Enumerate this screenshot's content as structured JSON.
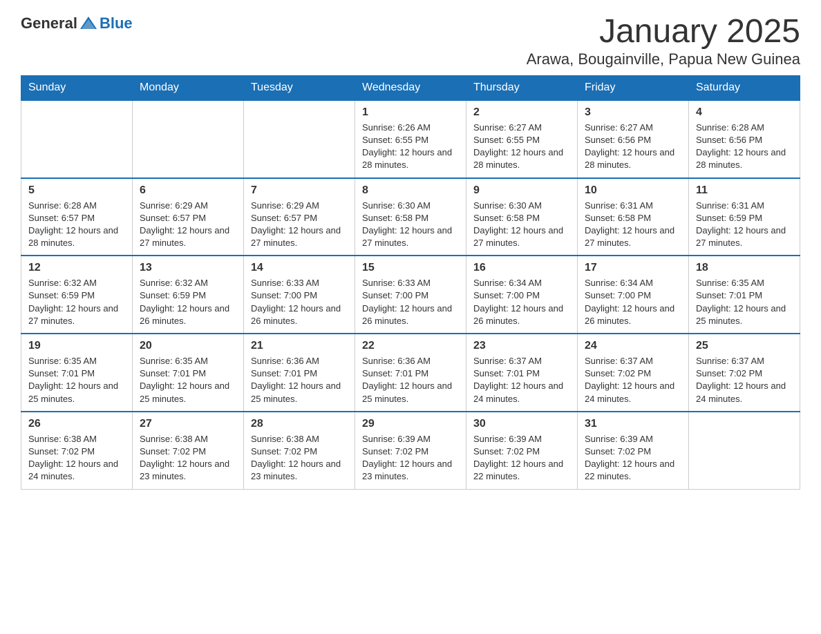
{
  "logo": {
    "text_general": "General",
    "text_blue": "Blue"
  },
  "header": {
    "month": "January 2025",
    "location": "Arawa, Bougainville, Papua New Guinea"
  },
  "days_of_week": [
    "Sunday",
    "Monday",
    "Tuesday",
    "Wednesday",
    "Thursday",
    "Friday",
    "Saturday"
  ],
  "weeks": [
    [
      {
        "day": "",
        "info": ""
      },
      {
        "day": "",
        "info": ""
      },
      {
        "day": "",
        "info": ""
      },
      {
        "day": "1",
        "info": "Sunrise: 6:26 AM\nSunset: 6:55 PM\nDaylight: 12 hours and 28 minutes."
      },
      {
        "day": "2",
        "info": "Sunrise: 6:27 AM\nSunset: 6:55 PM\nDaylight: 12 hours and 28 minutes."
      },
      {
        "day": "3",
        "info": "Sunrise: 6:27 AM\nSunset: 6:56 PM\nDaylight: 12 hours and 28 minutes."
      },
      {
        "day": "4",
        "info": "Sunrise: 6:28 AM\nSunset: 6:56 PM\nDaylight: 12 hours and 28 minutes."
      }
    ],
    [
      {
        "day": "5",
        "info": "Sunrise: 6:28 AM\nSunset: 6:57 PM\nDaylight: 12 hours and 28 minutes."
      },
      {
        "day": "6",
        "info": "Sunrise: 6:29 AM\nSunset: 6:57 PM\nDaylight: 12 hours and 27 minutes."
      },
      {
        "day": "7",
        "info": "Sunrise: 6:29 AM\nSunset: 6:57 PM\nDaylight: 12 hours and 27 minutes."
      },
      {
        "day": "8",
        "info": "Sunrise: 6:30 AM\nSunset: 6:58 PM\nDaylight: 12 hours and 27 minutes."
      },
      {
        "day": "9",
        "info": "Sunrise: 6:30 AM\nSunset: 6:58 PM\nDaylight: 12 hours and 27 minutes."
      },
      {
        "day": "10",
        "info": "Sunrise: 6:31 AM\nSunset: 6:58 PM\nDaylight: 12 hours and 27 minutes."
      },
      {
        "day": "11",
        "info": "Sunrise: 6:31 AM\nSunset: 6:59 PM\nDaylight: 12 hours and 27 minutes."
      }
    ],
    [
      {
        "day": "12",
        "info": "Sunrise: 6:32 AM\nSunset: 6:59 PM\nDaylight: 12 hours and 27 minutes."
      },
      {
        "day": "13",
        "info": "Sunrise: 6:32 AM\nSunset: 6:59 PM\nDaylight: 12 hours and 26 minutes."
      },
      {
        "day": "14",
        "info": "Sunrise: 6:33 AM\nSunset: 7:00 PM\nDaylight: 12 hours and 26 minutes."
      },
      {
        "day": "15",
        "info": "Sunrise: 6:33 AM\nSunset: 7:00 PM\nDaylight: 12 hours and 26 minutes."
      },
      {
        "day": "16",
        "info": "Sunrise: 6:34 AM\nSunset: 7:00 PM\nDaylight: 12 hours and 26 minutes."
      },
      {
        "day": "17",
        "info": "Sunrise: 6:34 AM\nSunset: 7:00 PM\nDaylight: 12 hours and 26 minutes."
      },
      {
        "day": "18",
        "info": "Sunrise: 6:35 AM\nSunset: 7:01 PM\nDaylight: 12 hours and 25 minutes."
      }
    ],
    [
      {
        "day": "19",
        "info": "Sunrise: 6:35 AM\nSunset: 7:01 PM\nDaylight: 12 hours and 25 minutes."
      },
      {
        "day": "20",
        "info": "Sunrise: 6:35 AM\nSunset: 7:01 PM\nDaylight: 12 hours and 25 minutes."
      },
      {
        "day": "21",
        "info": "Sunrise: 6:36 AM\nSunset: 7:01 PM\nDaylight: 12 hours and 25 minutes."
      },
      {
        "day": "22",
        "info": "Sunrise: 6:36 AM\nSunset: 7:01 PM\nDaylight: 12 hours and 25 minutes."
      },
      {
        "day": "23",
        "info": "Sunrise: 6:37 AM\nSunset: 7:01 PM\nDaylight: 12 hours and 24 minutes."
      },
      {
        "day": "24",
        "info": "Sunrise: 6:37 AM\nSunset: 7:02 PM\nDaylight: 12 hours and 24 minutes."
      },
      {
        "day": "25",
        "info": "Sunrise: 6:37 AM\nSunset: 7:02 PM\nDaylight: 12 hours and 24 minutes."
      }
    ],
    [
      {
        "day": "26",
        "info": "Sunrise: 6:38 AM\nSunset: 7:02 PM\nDaylight: 12 hours and 24 minutes."
      },
      {
        "day": "27",
        "info": "Sunrise: 6:38 AM\nSunset: 7:02 PM\nDaylight: 12 hours and 23 minutes."
      },
      {
        "day": "28",
        "info": "Sunrise: 6:38 AM\nSunset: 7:02 PM\nDaylight: 12 hours and 23 minutes."
      },
      {
        "day": "29",
        "info": "Sunrise: 6:39 AM\nSunset: 7:02 PM\nDaylight: 12 hours and 23 minutes."
      },
      {
        "day": "30",
        "info": "Sunrise: 6:39 AM\nSunset: 7:02 PM\nDaylight: 12 hours and 22 minutes."
      },
      {
        "day": "31",
        "info": "Sunrise: 6:39 AM\nSunset: 7:02 PM\nDaylight: 12 hours and 22 minutes."
      },
      {
        "day": "",
        "info": ""
      }
    ]
  ]
}
